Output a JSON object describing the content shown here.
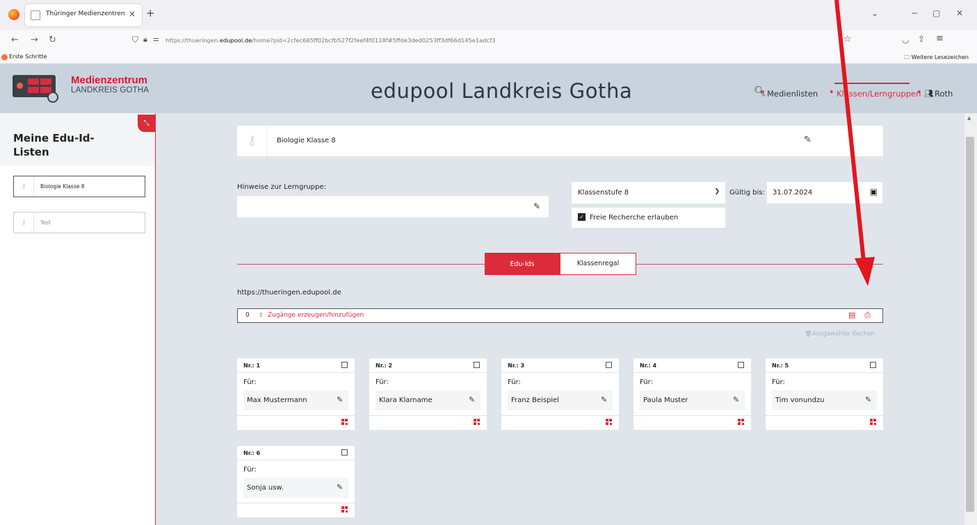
{
  "browser": {
    "tab_title": "Thüringer Medienzentren",
    "tab_close": "×",
    "new_tab": "+",
    "url_prefix": "https://thueringen.",
    "url_domain": "edupool.de",
    "url_path": "/home?pid=2cfec665ff02bcfb527f2feef4f0118f#5ffde3ded0253ff3df66d145e1adcf3",
    "bookmark_first": "Erste Schritte",
    "bookmark_other": "Weitere Lesezeichen"
  },
  "header": {
    "logo_title": "Medienzentrum",
    "logo_subtitle": "LANDKREIS GOTHA",
    "site_title": "edupool Landkreis Gotha",
    "nav": {
      "media_lists": "Medienlisten",
      "classes": "Klassen/Lerngruppen",
      "user": "Roth"
    },
    "separator": "•"
  },
  "sidebar": {
    "title": "Meine Edu-Id-Listen",
    "items": [
      {
        "label": "Biologie Klasse 8",
        "active": true
      },
      {
        "label": "Test",
        "active": false
      }
    ]
  },
  "main": {
    "list_name": "Biologie Klasse 8",
    "notes_label": "Hinweise zur Lerngruppe:",
    "notes_value": "",
    "grade_value": "Klassenstufe 8",
    "free_research_label": "Freie Recherche erlauben",
    "free_research_checked": true,
    "valid_label": "Gültig bis:",
    "valid_value": "31.07.2024",
    "tabs": [
      {
        "label": "Edu-Ids",
        "active": true
      },
      {
        "label": "Klassenregal",
        "active": false
      }
    ],
    "base_url": "https://thueringen.edupool.de",
    "generate": {
      "count": "0",
      "label": "Zugänge erzeugen/hinzufügen"
    },
    "delete_selected": "Ausgewählte löschen",
    "for_label": "Für:",
    "cards": [
      {
        "nr": "Nr.: 1",
        "name": "Max Mustermann"
      },
      {
        "nr": "Nr.: 2",
        "name": "Klara Klarname"
      },
      {
        "nr": "Nr.: 3",
        "name": "Franz Beispiel"
      },
      {
        "nr": "Nr.: 4",
        "name": "Paula Muster"
      },
      {
        "nr": "Nr.: 5",
        "name": "Tim vonundzu"
      },
      {
        "nr": "Nr.: 6",
        "name": "Sonja usw."
      }
    ]
  },
  "colors": {
    "accent": "#dc2b3b",
    "header_bg": "#c8d3dd",
    "main_bg": "#dfe5eb"
  }
}
